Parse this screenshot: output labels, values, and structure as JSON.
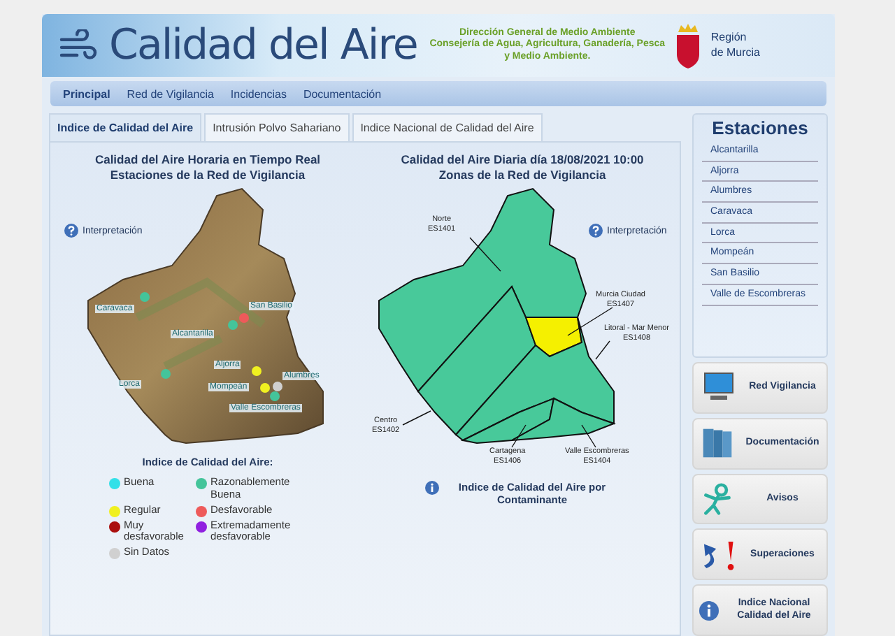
{
  "header": {
    "title": "Calidad del Aire",
    "org_lines": [
      "Dirección General de Medio Ambiente",
      "Consejería de Agua, Agricultura, Ganadería, Pesca y Medio Ambiente."
    ],
    "region": "Región de Murcia"
  },
  "nav": [
    {
      "label": "Principal",
      "selected": true
    },
    {
      "label": "Red de Vigilancia",
      "selected": false
    },
    {
      "label": "Incidencias",
      "selected": false
    },
    {
      "label": "Documentación",
      "selected": false
    }
  ],
  "tabs": [
    {
      "label": "Indice de Calidad del Aire",
      "selected": true
    },
    {
      "label": "Intrusión Polvo Sahariano",
      "selected": false
    },
    {
      "label": "Indice Nacional de Calidad del Aire",
      "selected": false
    }
  ],
  "realtime": {
    "title_lines": [
      "Calidad del Aire Horaria en Tiempo Real",
      "Estaciones de la Red de Vigilancia"
    ],
    "interpretation": "Interpretación",
    "stations": [
      {
        "name": "Caravaca",
        "color": "#44c49a"
      },
      {
        "name": "San Basilio",
        "color": "#ee5a5a"
      },
      {
        "name": "Alcantarilla",
        "color": "#44c49a"
      },
      {
        "name": "Aljorra",
        "color": "#f0f020"
      },
      {
        "name": "Alumbres",
        "color": "#d0d0d0"
      },
      {
        "name": "Lorca",
        "color": "#44c49a"
      },
      {
        "name": "Mompeán",
        "color": "#f0f020"
      },
      {
        "name": "Valle Escombreras",
        "color": "#44c49a"
      }
    ]
  },
  "daily": {
    "title_lines": [
      "Calidad del Aire Diaria día 18/08/2021 10:00",
      "Zonas de la Red de Vigilancia"
    ],
    "interpretation": "Interpretación",
    "zones": [
      {
        "name": "Norte",
        "code": "ES1401",
        "color": "#48c99a"
      },
      {
        "name": "Centro",
        "code": "ES1402",
        "color": "#48c99a"
      },
      {
        "name": "Murcia Ciudad",
        "code": "ES1407",
        "color": "#f5f000"
      },
      {
        "name": "Litoral - Mar Menor",
        "code": "ES1408",
        "color": "#48c99a"
      },
      {
        "name": "Cartagena",
        "code": "ES1406",
        "color": "#48c99a"
      },
      {
        "name": "Valle Escombreras",
        "code": "ES1404",
        "color": "#48c99a"
      }
    ],
    "pollutant_link": "Indice de Calidad del Aire por Contaminante"
  },
  "legend": {
    "title": "Indice de Calidad del Aire:",
    "items": [
      {
        "label": "Buena",
        "color": "#33e0e8"
      },
      {
        "label": "Razonablemente Buena",
        "color": "#44c49a"
      },
      {
        "label": "Regular",
        "color": "#f0f020"
      },
      {
        "label": "Desfavorable",
        "color": "#ee5a5a"
      },
      {
        "label": "Muy desfavorable",
        "color": "#aa0f0f"
      },
      {
        "label": "Extremadamente desfavorable",
        "color": "#9020e0"
      },
      {
        "label": "Sin Datos",
        "color": "#d0d0d0"
      }
    ]
  },
  "sidebar": {
    "title": "Estaciones",
    "stations": [
      "Alcantarilla",
      "Aljorra",
      "Alumbres",
      "Caravaca",
      "Lorca",
      "Mompeán",
      "San Basilio",
      "Valle de Escombreras"
    ],
    "buttons": [
      "Red Vigilancia",
      "Documentación",
      "Avisos",
      "Superaciones",
      "Indice Nacional Calidad del Aire"
    ]
  }
}
